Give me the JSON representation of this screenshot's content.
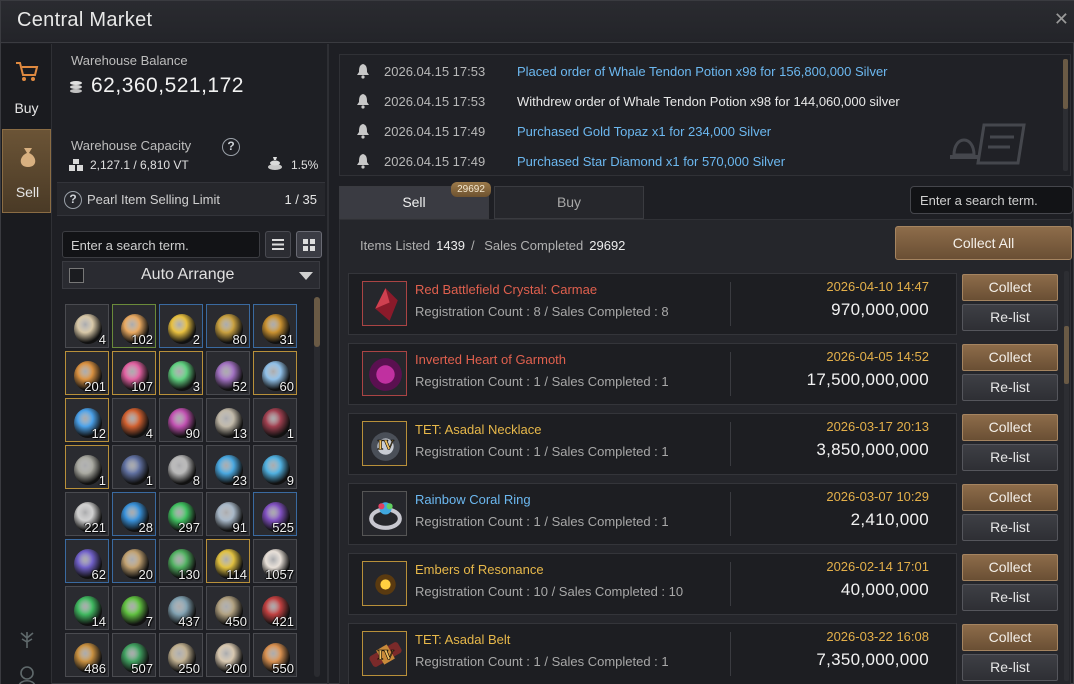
{
  "window": {
    "title": "Central Market",
    "close": "✕"
  },
  "nav": [
    {
      "label": "Buy",
      "icon": "cart-icon"
    },
    {
      "label": "Sell",
      "icon": "money-bag-icon",
      "active": true
    }
  ],
  "warehouse": {
    "balance_label": "Warehouse Balance",
    "balance_value": "62,360,521,172",
    "capacity_label": "Warehouse Capacity",
    "capacity_value": "2,127.1 / 6,810 VT",
    "tax_value": "1.5%",
    "help": "?"
  },
  "pearl": {
    "label": "Pearl Item Selling Limit",
    "count": "1 / 35",
    "help": "?"
  },
  "inventory": {
    "search_placeholder": "Enter a search term.",
    "arrange_label": "Auto Arrange",
    "slots": [
      {
        "count": "4",
        "color": "#d8c8a8",
        "border": "#4a4b50"
      },
      {
        "count": "102",
        "color": "#e8a860",
        "border": "#6a8a3a"
      },
      {
        "count": "2",
        "color": "#e8c040",
        "border": "#3a6aa0"
      },
      {
        "count": "80",
        "color": "#c8a040",
        "border": "#3a6aa0"
      },
      {
        "count": "31",
        "color": "#c89030",
        "border": "#3a6aa0"
      },
      {
        "count": "201",
        "color": "#d89040",
        "border": "#b8903a"
      },
      {
        "count": "107",
        "color": "#e060a0",
        "border": "#b8903a"
      },
      {
        "count": "3",
        "color": "#60d080",
        "border": "#b8903a"
      },
      {
        "count": "52",
        "color": "#a070c0",
        "border": "#4a4b50"
      },
      {
        "count": "60",
        "color": "#90c0e8",
        "border": "#b8903a"
      },
      {
        "count": "12",
        "color": "#4aa0e8",
        "border": "#b8903a"
      },
      {
        "count": "4",
        "color": "#d06030",
        "border": "#4a4b50"
      },
      {
        "count": "90",
        "color": "#c050b0",
        "border": "#4a4b50"
      },
      {
        "count": "13",
        "color": "#c0b8a8",
        "border": "#4a4b50"
      },
      {
        "count": "1",
        "color": "#a04050",
        "border": "#4a4b50"
      },
      {
        "count": "1",
        "color": "#a8a8a0",
        "border": "#b8903a"
      },
      {
        "count": "1",
        "color": "#6070a0",
        "border": "#4a4b50"
      },
      {
        "count": "8",
        "color": "#b8b8b8",
        "border": "#4a4b50"
      },
      {
        "count": "23",
        "color": "#4aa8e0",
        "border": "#4a4b50"
      },
      {
        "count": "9",
        "color": "#50b0e0",
        "border": "#4a4b50"
      },
      {
        "count": "221",
        "color": "#d0d0d0",
        "border": "#4a4b50"
      },
      {
        "count": "28",
        "color": "#3890d8",
        "border": "#3a6aa0"
      },
      {
        "count": "297",
        "color": "#40c060",
        "border": "#4a4b50"
      },
      {
        "count": "91",
        "color": "#a8b8c8",
        "border": "#4a4b50"
      },
      {
        "count": "525",
        "color": "#8050c0",
        "border": "#3a6aa0"
      },
      {
        "count": "62",
        "color": "#7060c8",
        "border": "#3a6aa0"
      },
      {
        "count": "20",
        "color": "#c0a070",
        "border": "#3a6aa0"
      },
      {
        "count": "130",
        "color": "#50b060",
        "border": "#4a4b50"
      },
      {
        "count": "114",
        "color": "#e0c040",
        "border": "#b8903a"
      },
      {
        "count": "1057",
        "color": "#e8e0d8",
        "border": "#4a4b50"
      },
      {
        "count": "14",
        "color": "#40b860",
        "border": "#4a4b50"
      },
      {
        "count": "7",
        "color": "#60c040",
        "border": "#4a4b50"
      },
      {
        "count": "437",
        "color": "#80a0b0",
        "border": "#4a4b50"
      },
      {
        "count": "450",
        "color": "#b0a080",
        "border": "#4a4b50"
      },
      {
        "count": "421",
        "color": "#c04040",
        "border": "#4a4b50"
      },
      {
        "count": "486",
        "color": "#c89040",
        "border": "#4a4b50"
      },
      {
        "count": "507",
        "color": "#40a060",
        "border": "#4a4b50"
      },
      {
        "count": "250",
        "color": "#c0b090",
        "border": "#4a4b50"
      },
      {
        "count": "200",
        "color": "#d8c8b0",
        "border": "#4a4b50"
      },
      {
        "count": "550",
        "color": "#d89050",
        "border": "#4a4b50"
      }
    ]
  },
  "log": [
    {
      "time": "2026.04.15 17:53",
      "msg": "Placed order of Whale Tendon Potion x98 for 156,800,000 Silver",
      "color": "#6cb8f0"
    },
    {
      "time": "2026.04.15 17:53",
      "msg": "Withdrew order of Whale Tendon Potion x98 for 144,060,000 silver",
      "color": "#e8e8e8"
    },
    {
      "time": "2026.04.15 17:49",
      "msg": "Purchased Gold Topaz x1 for 234,000 Silver",
      "color": "#6cb8f0"
    },
    {
      "time": "2026.04.15 17:49",
      "msg": "Purchased Star Diamond x1 for 570,000 Silver",
      "color": "#6cb8f0"
    }
  ],
  "tabs": {
    "sell": "Sell",
    "buy": "Buy",
    "badge": "29692"
  },
  "market_search_placeholder": "Enter a search term.",
  "stats": {
    "listed_label": "Items Listed",
    "listed": "1439",
    "sep": "/",
    "completed_label": "Sales Completed",
    "completed": "29692"
  },
  "collect_all": "Collect All",
  "buttons": {
    "collect": "Collect",
    "relist": "Re-list"
  },
  "listings": [
    {
      "name": "Red Battlefield Crystal: Carmae",
      "name_class": "c-red",
      "reg": "Registration Count : 8 / Sales Completed : 8",
      "date": "2026-04-10 14:47",
      "price": "970,000,000",
      "icon": "red-crystal-icon"
    },
    {
      "name": "Inverted Heart of Garmoth",
      "name_class": "c-red",
      "reg": "Registration Count : 1 / Sales Completed : 1",
      "date": "2026-04-05 14:52",
      "price": "17,500,000,000",
      "icon": "heart-icon"
    },
    {
      "name": "TET: Asadal Necklace",
      "name_class": "c-gold",
      "reg": "Registration Count : 1 / Sales Completed : 1",
      "date": "2026-03-17 20:13",
      "price": "3,850,000,000",
      "icon": "necklace-icon",
      "badge": "IV"
    },
    {
      "name": "Rainbow Coral Ring",
      "name_class": "c-blue",
      "reg": "Registration Count : 1 / Sales Completed : 1",
      "date": "2026-03-07 10:29",
      "price": "2,410,000",
      "icon": "ring-icon"
    },
    {
      "name": "Embers of Resonance",
      "name_class": "c-gold",
      "reg": "Registration Count : 10 / Sales Completed : 10",
      "date": "2026-02-14 17:01",
      "price": "40,000,000",
      "icon": "ember-icon"
    },
    {
      "name": "TET: Asadal Belt",
      "name_class": "c-gold",
      "reg": "Registration Count : 1 / Sales Completed : 1",
      "date": "2026-03-22 16:08",
      "price": "7,350,000,000",
      "icon": "belt-icon",
      "badge": "IV"
    }
  ]
}
